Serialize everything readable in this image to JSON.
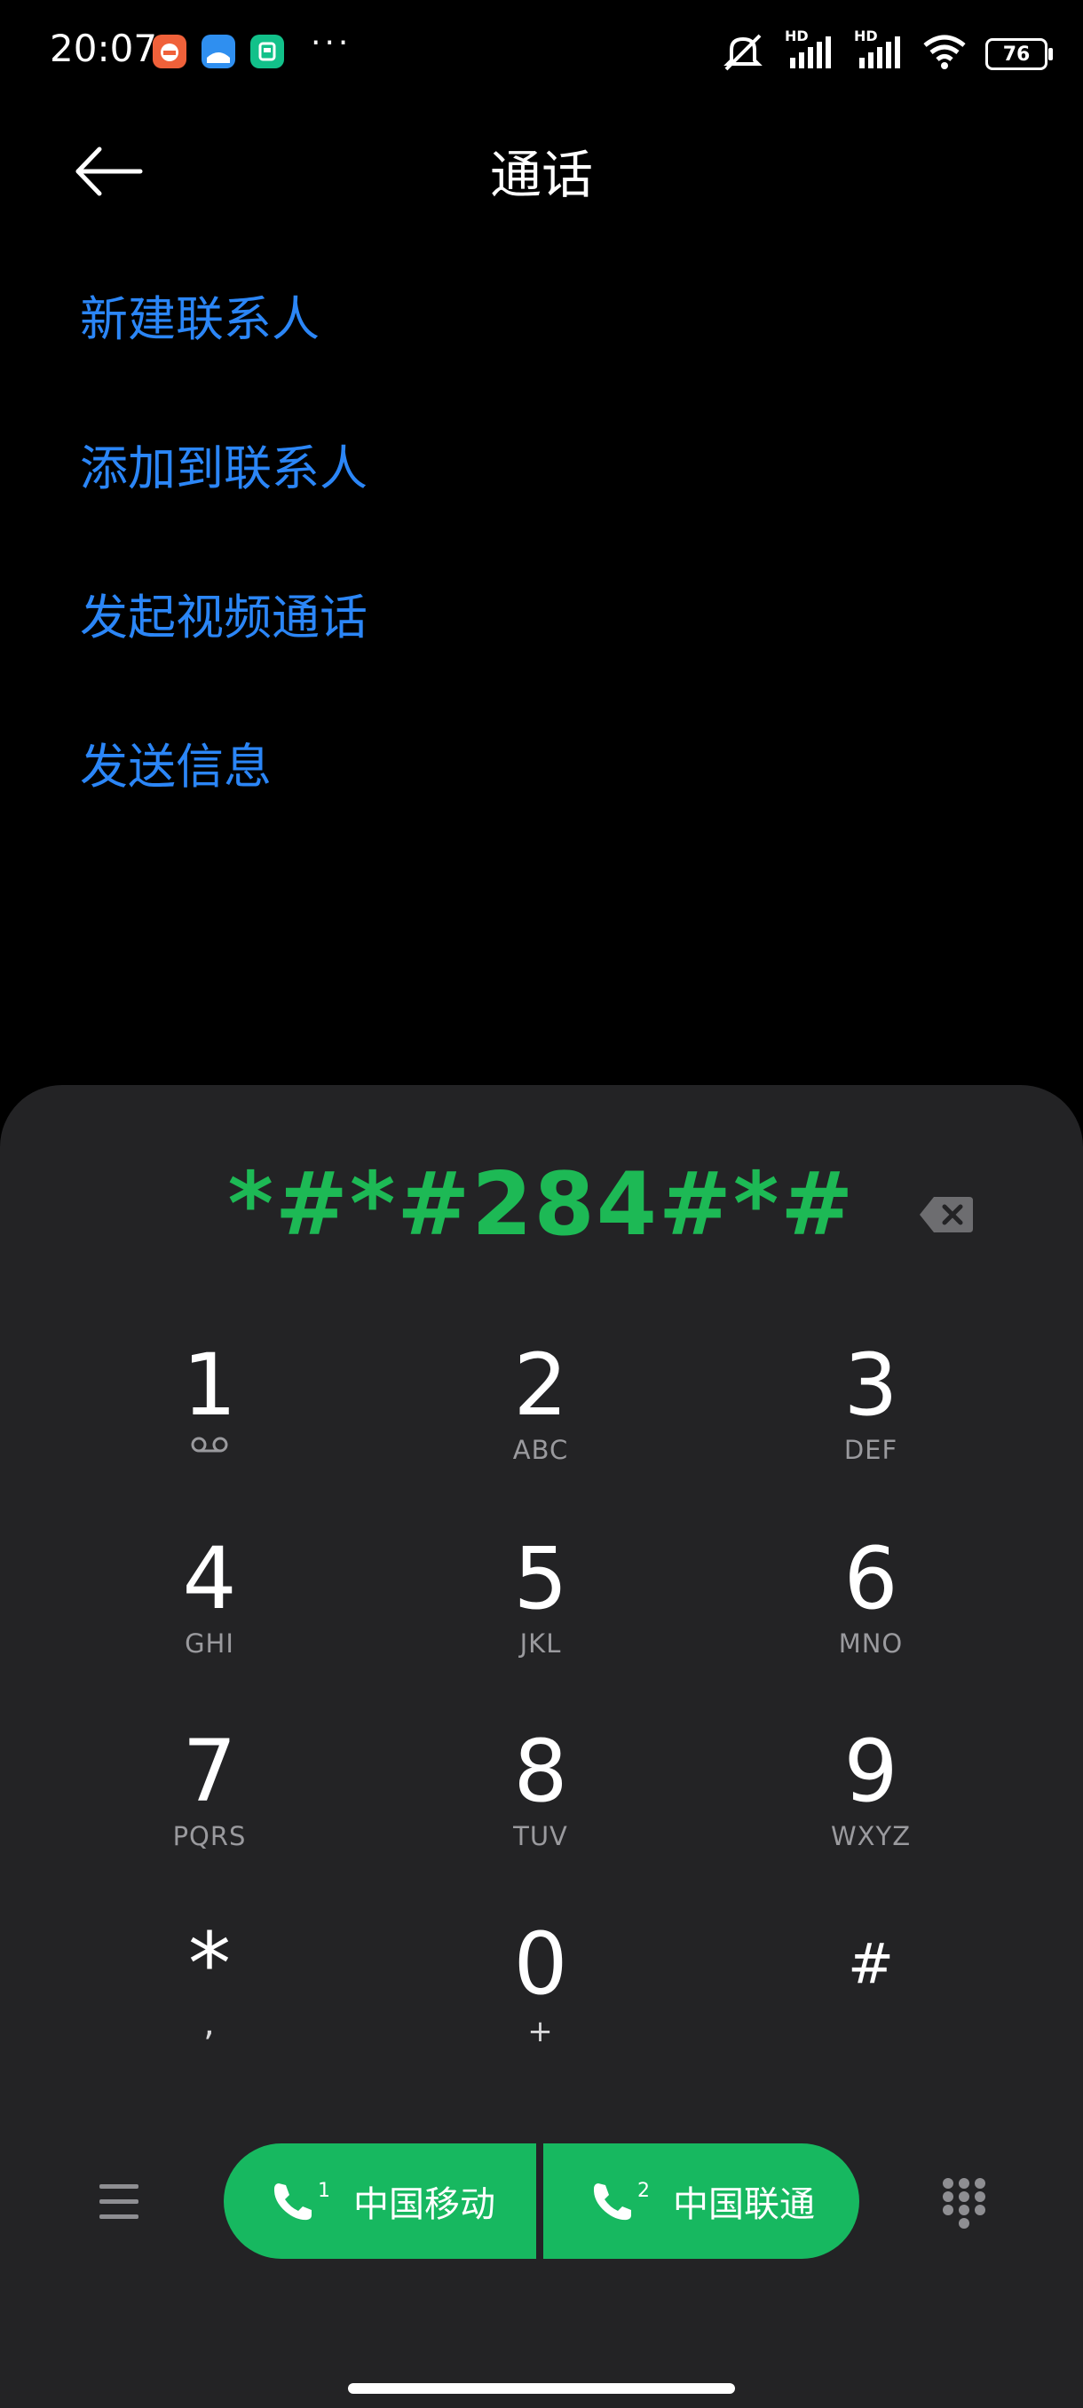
{
  "status_bar": {
    "time": "20:07",
    "apps": [
      "app-icon-orange",
      "app-icon-blue",
      "app-icon-green"
    ],
    "more": "···",
    "battery": "76",
    "hd1": "HD",
    "hd2": "HD"
  },
  "header": {
    "title": "通话"
  },
  "actions": [
    {
      "label": "新建联系人"
    },
    {
      "label": "添加到联系人"
    },
    {
      "label": "发起视频通话"
    },
    {
      "label": "发送信息"
    }
  ],
  "dialpad": {
    "number": "*#*#284#*#",
    "keys": [
      {
        "digit": "1",
        "letters": ""
      },
      {
        "digit": "2",
        "letters": "ABC"
      },
      {
        "digit": "3",
        "letters": "DEF"
      },
      {
        "digit": "4",
        "letters": "GHI"
      },
      {
        "digit": "5",
        "letters": "JKL"
      },
      {
        "digit": "6",
        "letters": "MNO"
      },
      {
        "digit": "7",
        "letters": "PQRS"
      },
      {
        "digit": "8",
        "letters": "TUV"
      },
      {
        "digit": "9",
        "letters": "WXYZ"
      },
      {
        "digit": "*",
        "letters": ","
      },
      {
        "digit": "0",
        "letters": "+"
      },
      {
        "digit": "#",
        "letters": ""
      }
    ]
  },
  "call_buttons": {
    "sim1": {
      "label": "中国移动",
      "sim": "1"
    },
    "sim2": {
      "label": "中国联通",
      "sim": "2"
    }
  },
  "colors": {
    "accent_blue": "#2b86f7",
    "call_green": "#17b860",
    "number_green": "#1db955",
    "panel": "#232325"
  }
}
